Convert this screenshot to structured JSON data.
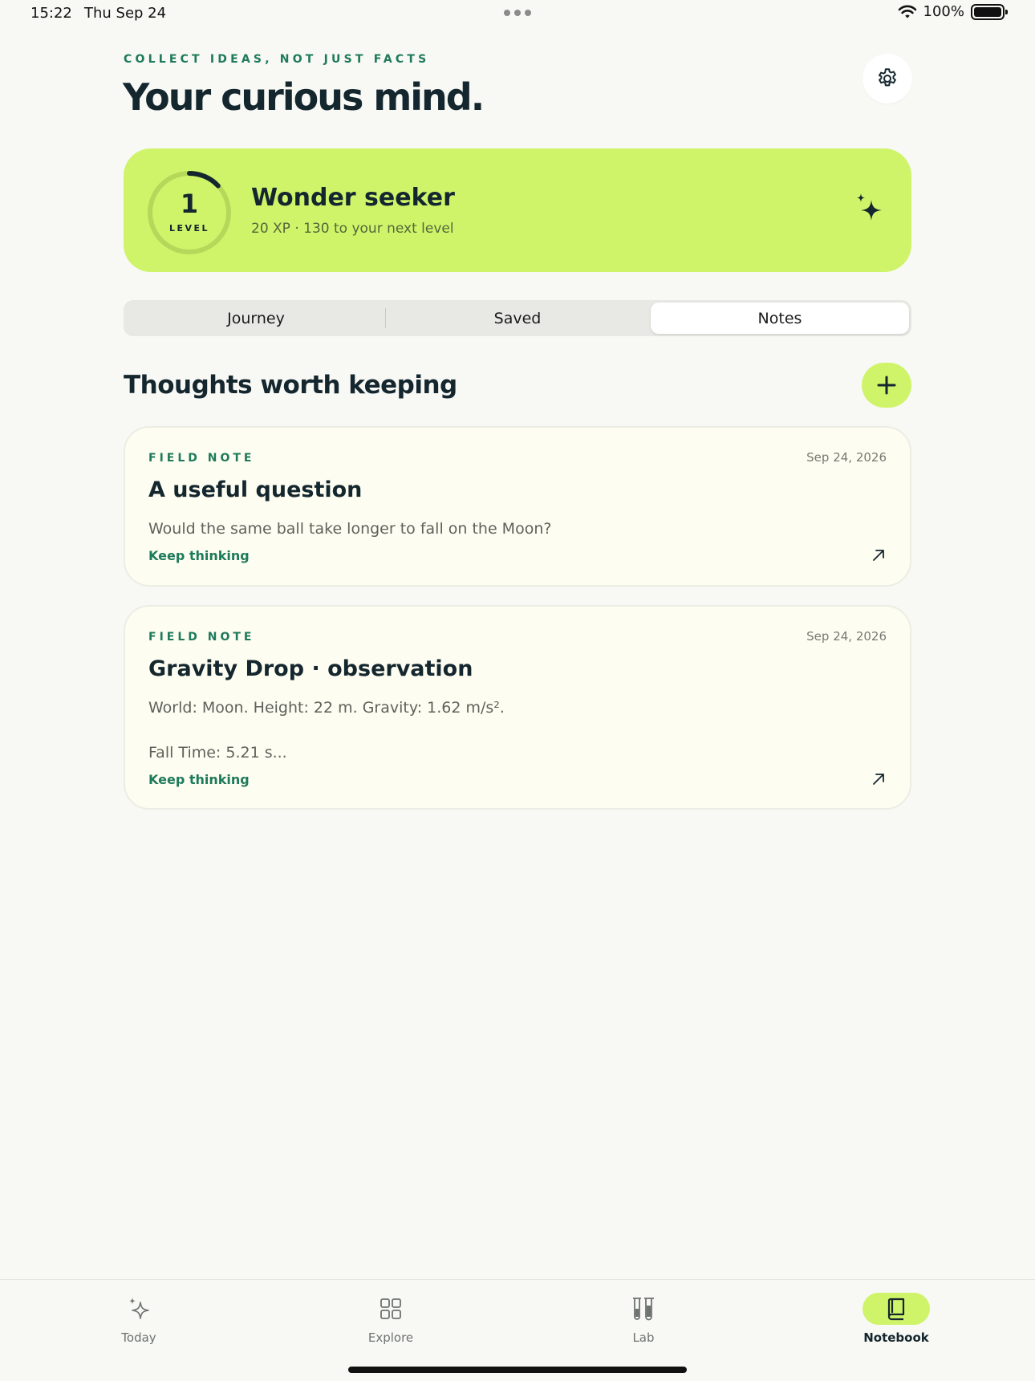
{
  "status_bar": {
    "time": "15:22",
    "date": "Thu Sep 24",
    "battery": "100%"
  },
  "header": {
    "eyebrow": "COLLECT IDEAS, NOT JUST FACTS",
    "title": "Your curious mind.",
    "settings_icon": "gear-icon"
  },
  "level_card": {
    "level_number": "1",
    "level_label": "LEVEL",
    "title": "Wonder seeker",
    "subtitle": "20 XP · 130 to your next level",
    "progress_fraction": 0.13,
    "accent_color": "#cff46a"
  },
  "segments": {
    "items": [
      {
        "label": "Journey"
      },
      {
        "label": "Saved"
      },
      {
        "label": "Notes"
      }
    ],
    "selected": "Notes"
  },
  "section": {
    "title": "Thoughts worth keeping"
  },
  "notes": [
    {
      "kind": "FIELD NOTE",
      "date": "Sep 24, 2026",
      "title": "A useful question",
      "body_line1": "Would the same ball take longer to fall on the Moon?",
      "body_line2": "",
      "link": "Keep thinking"
    },
    {
      "kind": "FIELD NOTE",
      "date": "Sep 24, 2026",
      "title": "Gravity Drop · observation",
      "body_line1": "World: Moon. Height: 22 m. Gravity: 1.62 m/s².",
      "body_line2": "Fall Time: 5.21 s...",
      "link": "Keep thinking"
    }
  ],
  "tabbar": {
    "items": [
      {
        "label": "Today",
        "icon": "sparkle-icon"
      },
      {
        "label": "Explore",
        "icon": "grid-icon"
      },
      {
        "label": "Lab",
        "icon": "test-tubes-icon"
      },
      {
        "label": "Notebook",
        "icon": "notebook-icon"
      }
    ],
    "selected": "Notebook"
  },
  "colors": {
    "accent_lime": "#cff46a",
    "green_text": "#1d7a5a",
    "ink": "#14262e",
    "card_bg": "#fefdf1"
  }
}
